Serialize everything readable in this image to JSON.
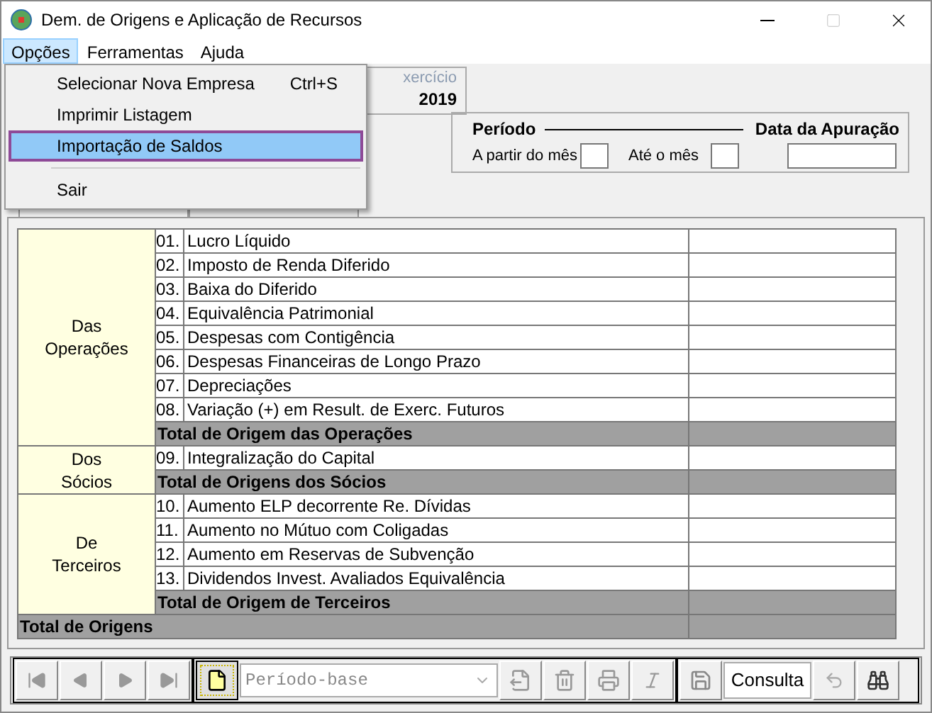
{
  "window": {
    "title": "Dem. de Origens e Aplicação de Recursos",
    "maximize_disabled": true
  },
  "menubar": [
    {
      "label": "Opções",
      "selected": true
    },
    {
      "label": "Ferramentas",
      "selected": false
    },
    {
      "label": "Ajuda",
      "selected": false
    }
  ],
  "menu": [
    {
      "kind": "item",
      "label": "Selecionar Nova Empresa",
      "shortcut": "Ctrl+S",
      "selected": false
    },
    {
      "kind": "item",
      "label": "Imprimir Listagem",
      "selected": false
    },
    {
      "kind": "item",
      "label": "Importação de Saldos",
      "selected": true
    },
    {
      "kind": "separator"
    },
    {
      "kind": "item",
      "label": "Sair",
      "selected": false
    }
  ],
  "exercicio": {
    "label": "xercício",
    "value": "2019"
  },
  "periodo": {
    "title": "Período",
    "from_label": "A partir do mês",
    "to_label": "Até o mês",
    "date_title": "Data da Apuração"
  },
  "tabs": [
    {
      "selected": true
    },
    {
      "selected": false
    }
  ],
  "table": {
    "groups": [
      {
        "label": "Das Operações",
        "items": [
          {
            "number": "01.",
            "label": "Lucro Líquido"
          },
          {
            "number": "02.",
            "label": "Imposto de Renda Diferido"
          },
          {
            "number": "03.",
            "label": "Baixa do Diferido"
          },
          {
            "number": "04.",
            "label": "Equivalência Patrimonial"
          },
          {
            "number": "05.",
            "label": "Despesas com Contigência"
          },
          {
            "number": "06.",
            "label": "Despesas Financeiras de Longo Prazo"
          },
          {
            "number": "07.",
            "label": "Depreciações"
          },
          {
            "number": "08.",
            "label": "Variação (+) em Result. de Exerc. Futuros"
          }
        ],
        "total": "Total de Origem das Operações"
      },
      {
        "label": "Dos Sócios",
        "items": [
          {
            "number": "09.",
            "label": "Integralização do Capital"
          }
        ],
        "total": "Total de Origens dos Sócios"
      },
      {
        "label": "De Terceiros",
        "items": [
          {
            "number": "10.",
            "label": "Aumento ELP decorrente Re. Dívidas"
          },
          {
            "number": "11.",
            "label": "Aumento no Mútuo com Coligadas"
          },
          {
            "number": "12.",
            "label": "Aumento em Reservas de Subvenção"
          },
          {
            "number": "13.",
            "label": "Dividendos Invest. Avaliados Equivalência"
          }
        ],
        "total": "Total de Origem de Terceiros"
      }
    ],
    "grand_total": "Total de Origens"
  },
  "toolbar": {
    "nav": [
      {
        "kind": "first",
        "disabled": true
      },
      {
        "kind": "prev",
        "disabled": true
      },
      {
        "kind": "next",
        "disabled": true
      },
      {
        "kind": "last",
        "disabled": true
      }
    ],
    "new_active": true,
    "period_placeholder": "Período-base",
    "actions": [
      {
        "kind": "export",
        "disabled": true
      },
      {
        "kind": "delete",
        "disabled": true
      },
      {
        "kind": "print",
        "disabled": true
      },
      {
        "kind": "italic",
        "disabled": true
      }
    ],
    "save_disabled": true,
    "mode": "Consulta",
    "undo_disabled": true
  }
}
